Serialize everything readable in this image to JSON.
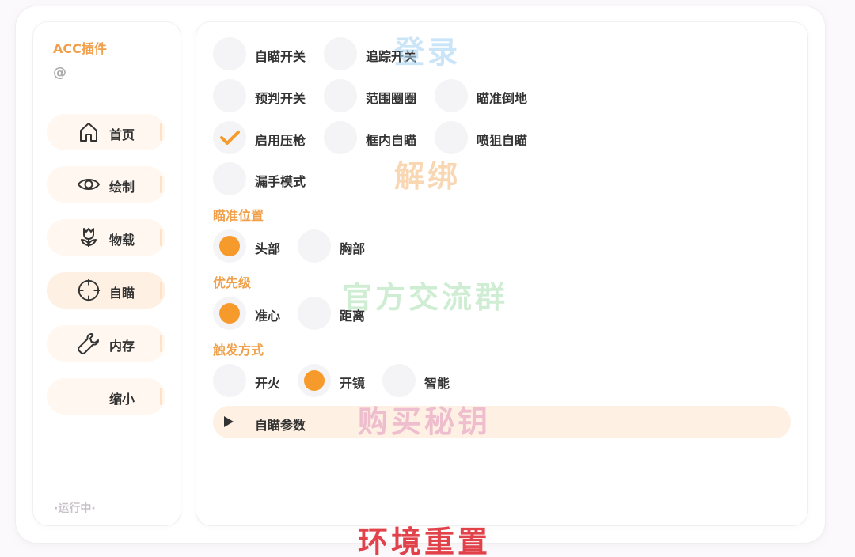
{
  "sidebar": {
    "title": "ACC插件",
    "at": "@",
    "status": "·运行中·",
    "items": [
      {
        "label": "首页",
        "icon": "home-icon"
      },
      {
        "label": "绘制",
        "icon": "eye-icon"
      },
      {
        "label": "物载",
        "icon": "tulip-icon"
      },
      {
        "label": "自瞄",
        "icon": "crosshair-icon"
      },
      {
        "label": "内存",
        "icon": "wrench-icon"
      },
      {
        "label": "缩小",
        "icon": ""
      }
    ],
    "active_item": "自瞄"
  },
  "toggles": [
    {
      "label": "自瞄开关",
      "checked": false
    },
    {
      "label": "追踪开关",
      "checked": false
    },
    {
      "label": "预判开关",
      "checked": false
    },
    {
      "label": "范围圈圈",
      "checked": false
    },
    {
      "label": "瞄准倒地",
      "checked": false
    },
    {
      "label": "启用压枪",
      "checked": true
    },
    {
      "label": "框内自瞄",
      "checked": false
    },
    {
      "label": "喷狙自瞄",
      "checked": false
    },
    {
      "label": "漏手模式",
      "checked": false
    }
  ],
  "aim_position": {
    "label": "瞄准位置",
    "options": [
      "头部",
      "胸部"
    ],
    "selected": "头部"
  },
  "priority": {
    "label": "优先级",
    "options": [
      "准心",
      "距离"
    ],
    "selected": "准心"
  },
  "trigger": {
    "label": "触发方式",
    "options": [
      "开火",
      "开镜",
      "智能"
    ],
    "selected": "开镜"
  },
  "params": {
    "label": "自瞄参数",
    "expanded": false
  },
  "watermarks": {
    "login": "登录",
    "unbind": "解绑",
    "group": "官方交流群",
    "buy": "购买秘钥",
    "reset": "环境重置"
  },
  "colors": {
    "accent": "#f79a2c",
    "label": "#f0a04b",
    "reset": "#e0323a"
  }
}
